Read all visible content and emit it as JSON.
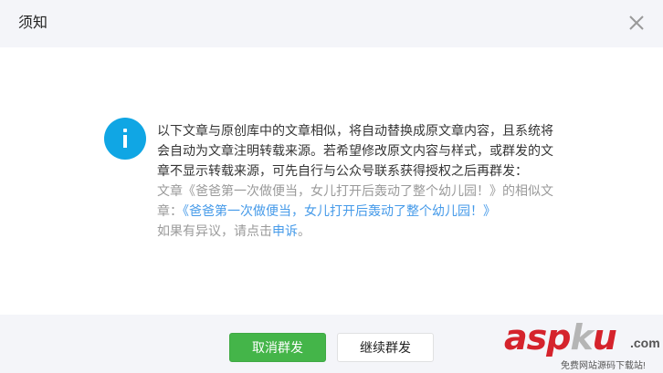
{
  "dialog": {
    "title": "须知",
    "close_icon": "close-icon"
  },
  "message": {
    "icon": "info-icon",
    "line1": "以下文章与原创库中的文章相似，将自动替换成原文章内容，且系统将",
    "line2": "会自动为文章注明转载来源。若希望修改原文内容与样式，或群发的文",
    "line3": "章不显示转载来源，可先自行与公众号联系获得授权之后再群发：",
    "line4": "文章《爸爸第一次做便当，女儿打开后轰动了整个幼儿园！》的相似文",
    "line5_prefix": "章：",
    "line5_link": "《爸爸第一次做便当，女儿打开后轰动了整个幼儿园！》",
    "line6_prefix": "如果有异议，请点击",
    "line6_link": "申诉",
    "line6_suffix": "。"
  },
  "footer": {
    "cancel_label": "取消群发",
    "continue_label": "继续群发"
  },
  "watermark": {
    "main_a": "asp",
    "main_k": "k",
    "main_u": "u",
    "domain": ".com",
    "sub": "免费网站源码下载站!"
  },
  "colors": {
    "primary_button": "#44b549",
    "info_icon": "#10a6e4",
    "link": "#459ae9"
  }
}
